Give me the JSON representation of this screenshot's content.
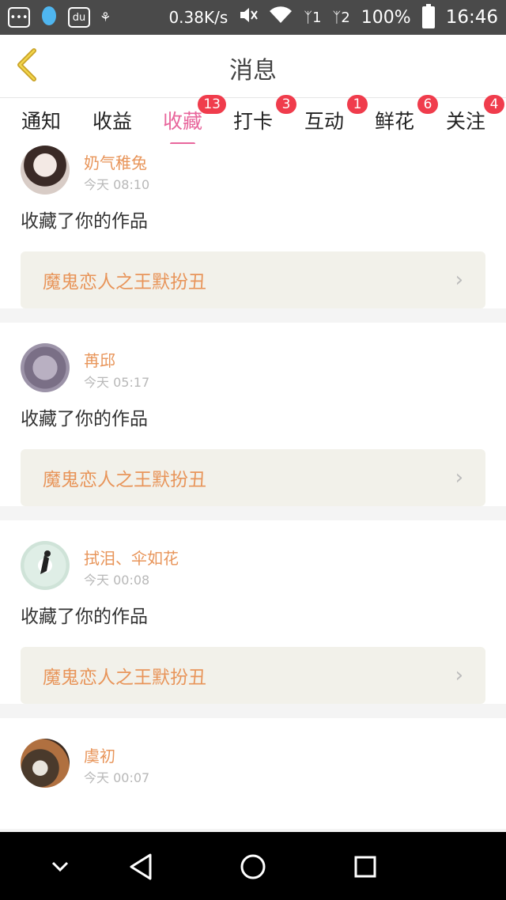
{
  "status_bar": {
    "net_speed": "0.38K/s",
    "sim1": "1",
    "sim2": "2",
    "battery": "100%",
    "time": "16:46",
    "icons": [
      "message-icon",
      "qq-penguin-icon",
      "baidu-paw-icon",
      "app-icon",
      "mute-icon",
      "wifi-icon",
      "signal-icon",
      "battery-icon"
    ]
  },
  "header": {
    "title": "消息"
  },
  "tabs": [
    {
      "label": "通知",
      "badge": ""
    },
    {
      "label": "收益",
      "badge": ""
    },
    {
      "label": "收藏",
      "badge": "13",
      "active": true
    },
    {
      "label": "打卡",
      "badge": "3"
    },
    {
      "label": "互动",
      "badge": "1"
    },
    {
      "label": "鲜花",
      "badge": "6"
    },
    {
      "label": "关注",
      "badge": "4"
    }
  ],
  "feed": [
    {
      "user": "奶气稚兔",
      "time": "今天 08:10",
      "action": "收藏了你的作品",
      "work": "魔鬼恋人之王默扮丑"
    },
    {
      "user": "苒邱",
      "time": "今天 05:17",
      "action": "收藏了你的作品",
      "work": "魔鬼恋人之王默扮丑"
    },
    {
      "user": "拭泪、伞如花",
      "time": "今天 00:08",
      "action": "收藏了你的作品",
      "work": "魔鬼恋人之王默扮丑"
    },
    {
      "user": "虞初",
      "time": "今天 00:07",
      "action": "",
      "work": ""
    }
  ],
  "colors": {
    "accent": "#e8669c",
    "username": "#e8955a",
    "badge": "#f03c4c",
    "status_bar": "#4a4a4a",
    "back_arrow": "#c9a227"
  }
}
